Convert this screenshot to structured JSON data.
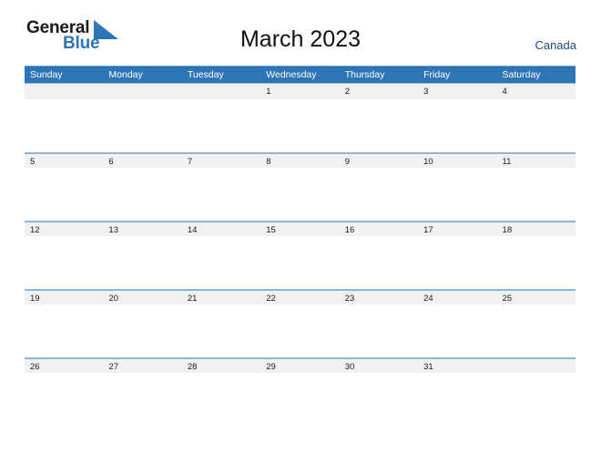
{
  "brand": {
    "name_part1": "General",
    "name_part2": "Blue",
    "flag_icon": "blue-triangle-flag-icon",
    "primary_color": "#2E75B6"
  },
  "header": {
    "title": "March 2023",
    "country": "Canada"
  },
  "calendar": {
    "month": "March",
    "year": "2023",
    "weekday_headers": [
      "Sunday",
      "Monday",
      "Tuesday",
      "Wednesday",
      "Thursday",
      "Friday",
      "Saturday"
    ],
    "header_background": "#2E75B6",
    "header_text_color": "#FFFFFF",
    "date_band_background": "#F1F1F1",
    "separator_color": "#8FB4D9",
    "weeks": [
      {
        "days": [
          "",
          "",
          "",
          "1",
          "2",
          "3",
          "4"
        ]
      },
      {
        "days": [
          "5",
          "6",
          "7",
          "8",
          "9",
          "10",
          "11"
        ]
      },
      {
        "days": [
          "12",
          "13",
          "14",
          "15",
          "16",
          "17",
          "18"
        ]
      },
      {
        "days": [
          "19",
          "20",
          "21",
          "22",
          "23",
          "24",
          "25"
        ]
      },
      {
        "days": [
          "26",
          "27",
          "28",
          "29",
          "30",
          "31",
          ""
        ]
      }
    ]
  }
}
